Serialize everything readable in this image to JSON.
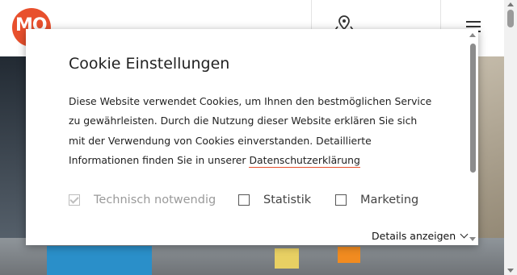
{
  "brand": {
    "logo_text": "MO",
    "logo_color": "#e8502d"
  },
  "header": {
    "map_icon": "map-pin-icon",
    "menu_icon": "hamburger-menu-icon"
  },
  "cookie_dialog": {
    "title": "Cookie Einstellungen",
    "text_before_link": "Diese Website verwendet Cookies, um Ihnen den bestmöglichen Service zu gewährleisten. Durch die Nutzung dieser Website erklären Sie sich mit der Verwendung von Cookies einverstanden. Detaillierte Informationen finden Sie in unserer ",
    "link_text": "Datenschutzerklärung",
    "link_underline_color": "#e8502d",
    "options": [
      {
        "label": "Technisch notwendig",
        "checked": true,
        "disabled": true
      },
      {
        "label": "Statistik",
        "checked": false,
        "disabled": false
      },
      {
        "label": "Marketing",
        "checked": false,
        "disabled": false
      }
    ],
    "details_label": "Details anzeigen"
  }
}
